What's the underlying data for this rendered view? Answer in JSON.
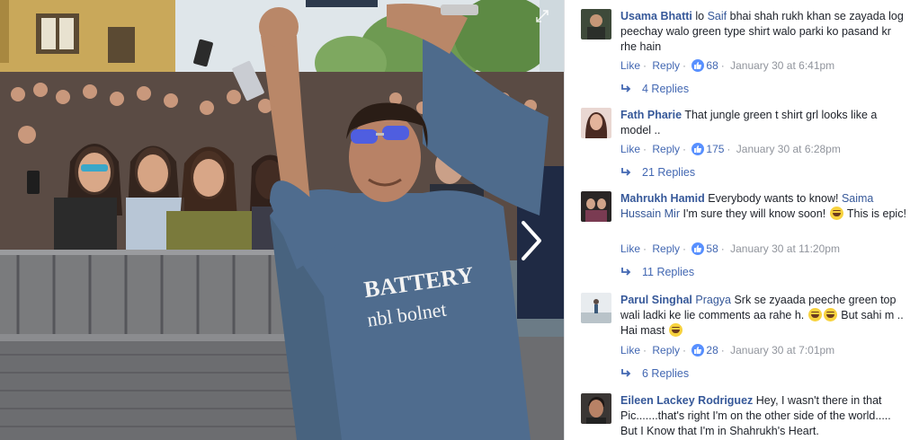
{
  "photo": {
    "shirt_text_line1": "BATTERY",
    "shirt_text_line2": "nbl bolnet",
    "icons": {
      "expand": "expand-icon",
      "next": "chevron-right-icon"
    }
  },
  "comments": [
    {
      "author": "Usama Bhatti",
      "mention": "Saif",
      "text_before": "lo",
      "text_after": "bhai shah rukh khan se zayada log peechay walo green type shirt walo parki ko pasand kr rhe hain",
      "like_label": "Like",
      "reply_label": "Reply",
      "like_count": "68",
      "timestamp": "January 30 at 6:41pm",
      "replies_label": "4 Replies"
    },
    {
      "author": "Fath Pharie",
      "text": "That jungle green t shirt grl looks like a model ..",
      "like_label": "Like",
      "reply_label": "Reply",
      "like_count": "175",
      "timestamp": "January 30 at 6:28pm",
      "replies_label": "21 Replies"
    },
    {
      "author": "Mahrukh Hamid",
      "text_before": "Everybody wants to know!",
      "mention": "Saima Hussain Mir",
      "text_after": "I'm sure they will know soon!",
      "text_end": "This is epic!",
      "like_label": "Like",
      "reply_label": "Reply",
      "like_count": "58",
      "timestamp": "January 30 at 11:20pm",
      "replies_label": "11 Replies"
    },
    {
      "author": "Parul Singhal",
      "mention": "Pragya",
      "text_after": "Srk se zyaada peeche green top wali ladki ke lie comments aa rahe h.",
      "text_end": "But sahi m .. Hai mast",
      "like_label": "Like",
      "reply_label": "Reply",
      "like_count": "28",
      "timestamp": "January 30 at 7:01pm",
      "replies_label": "6 Replies"
    },
    {
      "author": "Eileen Lackey Rodriguez",
      "text": "Hey, I wasn't there in that Pic.......that's right I'm on the other side of the world..... But I Know that I'm in Shahrukh's Heart."
    }
  ],
  "colors": {
    "link": "#365899",
    "action": "#4267b2",
    "meta": "#90949c",
    "like_badge": "#5890ff"
  }
}
